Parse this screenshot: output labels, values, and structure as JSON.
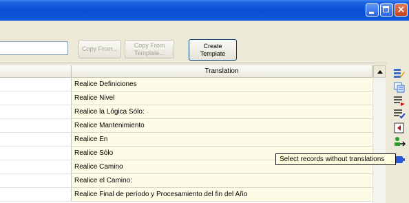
{
  "toolbar": {
    "copy_from_label": "Copy From...",
    "copy_from_template_label_1": "Copy From",
    "copy_from_template_label_2": "Template...",
    "create_template_label_1": "Create",
    "create_template_label_2": "Template"
  },
  "grid": {
    "column_header_translation": "Translation",
    "rows": [
      "Realice Definiciones",
      "Realice Nivel",
      "Realice la Lógica Sólo:",
      "Realice Mantenimiento",
      "Realice En",
      "Realice Sólo",
      "Realice Camino",
      "Realice el Camino:",
      "Realice Final de período y Procesamiento del fin del Año"
    ]
  },
  "tooltip": {
    "text": "Select records without translations"
  },
  "sidebar": {
    "icons": [
      "edit-records-icon",
      "copy-records-icon",
      "filter-red-icon",
      "filter-blue-icon",
      "undo-record-icon",
      "select-records-without-translations-icon",
      "tag-icon"
    ]
  },
  "colors": {
    "titlebar": "#0b51d8",
    "row_background": "#fdfde7",
    "tooltip_background": "#ffffe1"
  }
}
